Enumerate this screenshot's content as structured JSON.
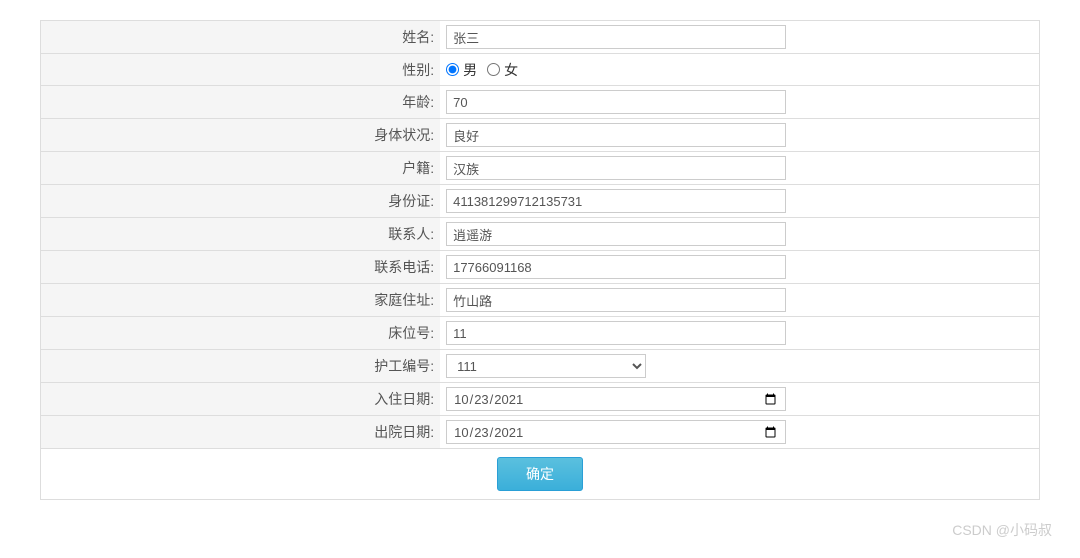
{
  "form": {
    "name": {
      "label": "姓名:",
      "value": "张三"
    },
    "gender": {
      "label": "性别:",
      "male": "男",
      "female": "女",
      "selected": "male"
    },
    "age": {
      "label": "年龄:",
      "value": "70"
    },
    "health": {
      "label": "身体状况:",
      "value": "良好"
    },
    "ethnicity": {
      "label": "户籍:",
      "value": "汉族"
    },
    "idcard": {
      "label": "身份证:",
      "value": "411381299712135731"
    },
    "contact": {
      "label": "联系人:",
      "value": "逍遥游"
    },
    "phone": {
      "label": "联系电话:",
      "value": "17766091168"
    },
    "address": {
      "label": "家庭住址:",
      "value": "竹山路"
    },
    "bed": {
      "label": "床位号:",
      "value": "11"
    },
    "nurse": {
      "label": "护工编号:",
      "value": "111"
    },
    "checkin": {
      "label": "入住日期:",
      "value": "2021/10/23",
      "iso": "2021-10-23"
    },
    "checkout": {
      "label": "出院日期:",
      "value": "2021/10/23",
      "iso": "2021-10-23"
    }
  },
  "submit_label": "确定",
  "watermark": "CSDN @小码叔"
}
